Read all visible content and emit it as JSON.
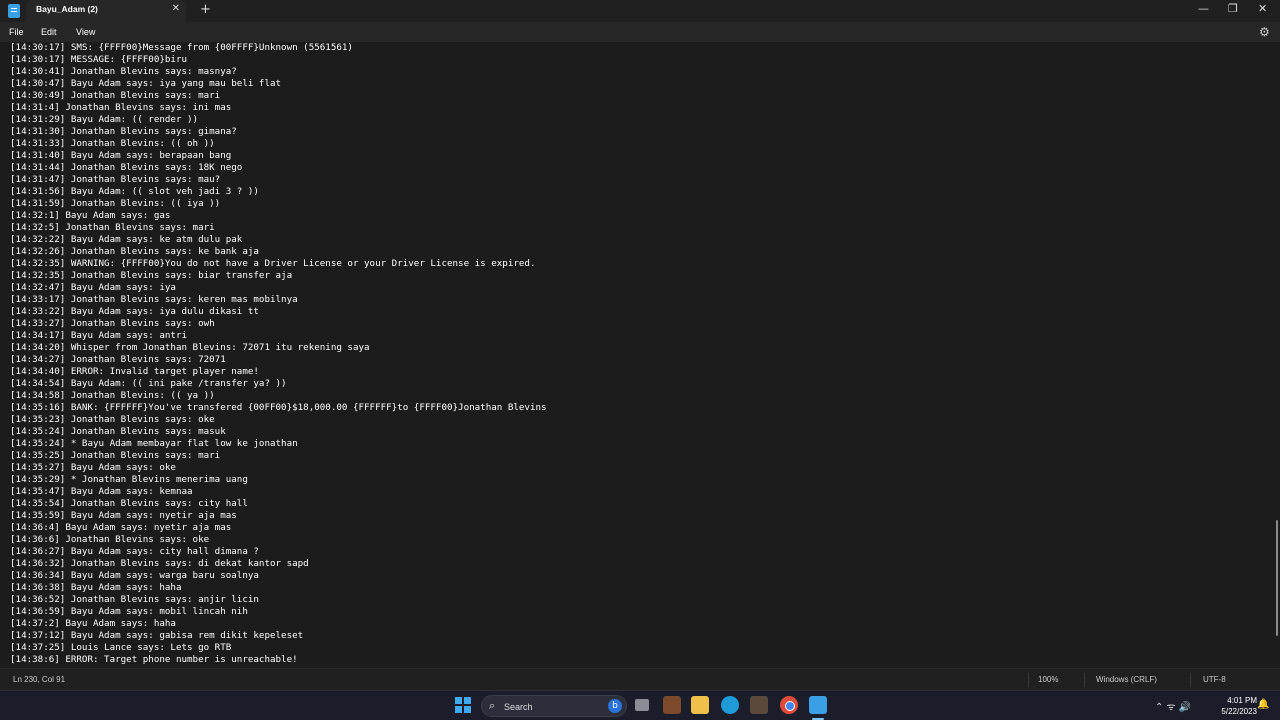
{
  "window": {
    "tab_title": "Bayu_Adam (2)",
    "tab_close": "✕",
    "tab_add": "+",
    "minimize": "—",
    "maximize": "❐",
    "close": "✕"
  },
  "menu": {
    "file": "File",
    "edit": "Edit",
    "view": "View",
    "settings_icon": "gear-icon"
  },
  "lines": [
    "[14:30:17] SMS: {FFFF00}Message from {00FFFF}Unknown (5561561)",
    "[14:30:17] MESSAGE: {FFFF00}biru",
    "[14:30:41] Jonathan Blevins says: masnya?",
    "[14:30:47] Bayu Adam says: iya yang mau beli flat",
    "[14:30:49] Jonathan Blevins says: mari",
    "[14:31:4] Jonathan Blevins says: ini mas",
    "[14:31:29] Bayu Adam: (( render ))",
    "[14:31:30] Jonathan Blevins says: gimana?",
    "[14:31:33] Jonathan Blevins: (( oh ))",
    "[14:31:40] Bayu Adam says: berapaan bang",
    "[14:31:44] Jonathan Blevins says: 18K nego",
    "[14:31:47] Jonathan Blevins says: mau?",
    "[14:31:56] Bayu Adam: (( slot veh jadi 3 ? ))",
    "[14:31:59] Jonathan Blevins: (( iya ))",
    "[14:32:1] Bayu Adam says: gas",
    "[14:32:5] Jonathan Blevins says: mari",
    "[14:32:22] Bayu Adam says: ke atm dulu pak",
    "[14:32:26] Jonathan Blevins says: ke bank aja",
    "[14:32:35] WARNING: {FFFF00}You do not have a Driver License or your Driver License is expired.",
    "[14:32:35] Jonathan Blevins says: biar transfer aja",
    "[14:32:47] Bayu Adam says: iya",
    "[14:33:17] Jonathan Blevins says: keren mas mobilnya",
    "[14:33:22] Bayu Adam says: iya dulu dikasi tt",
    "[14:33:27] Jonathan Blevins says: owh",
    "[14:34:17] Bayu Adam says: antri",
    "[14:34:20] Whisper from Jonathan Blevins: 72071 itu rekening saya",
    "[14:34:27] Jonathan Blevins says: 72071",
    "[14:34:40] ERROR: Invalid target player name!",
    "[14:34:54] Bayu Adam: (( ini pake /transfer ya? ))",
    "[14:34:58] Jonathan Blevins: (( ya ))",
    "[14:35:16] BANK: {FFFFFF}You've transfered {00FF00}$18,000.00 {FFFFFF}to {FFFF00}Jonathan Blevins",
    "[14:35:23] Jonathan Blevins says: oke",
    "[14:35:24] Jonathan Blevins says: masuk",
    "[14:35:24] * Bayu Adam membayar flat low ke jonathan",
    "[14:35:25] Jonathan Blevins says: mari",
    "[14:35:27] Bayu Adam says: oke",
    "[14:35:29] * Jonathan Blevins menerima uang",
    "[14:35:47] Bayu Adam says: kemnaa",
    "[14:35:54] Jonathan Blevins says: city hall",
    "[14:35:59] Bayu Adam says: nyetir aja mas",
    "[14:36:4] Bayu Adam says: nyetir aja mas",
    "[14:36:6] Jonathan Blevins says: oke",
    "[14:36:27] Bayu Adam says: city hall dimana ?",
    "[14:36:32] Jonathan Blevins says: di dekat kantor sapd",
    "[14:36:34] Bayu Adam says: warga baru soalnya",
    "[14:36:38] Bayu Adam says: haha",
    "[14:36:52] Jonathan Blevins says: anjir licin",
    "[14:36:59] Bayu Adam says: mobil lincah nih",
    "[14:37:2] Bayu Adam says: haha",
    "[14:37:12] Bayu Adam says: gabisa rem dikit kepeleset",
    "[14:37:25] Louis Lance says: Lets go RTB",
    "[14:38:6] ERROR: Target phone number is unreachable!"
  ],
  "status": {
    "position": "Ln 230, Col 91",
    "zoom": "100%",
    "line_ending": "Windows (CRLF)",
    "encoding": "UTF-8"
  },
  "taskbar": {
    "search_label": "Search",
    "search_icon": "search-icon",
    "bing_label": "b",
    "tray_icons": "⌃ ᯤ 🔊",
    "time": "4:01 PM",
    "date": "5/22/2023",
    "notification_icon": "🔔"
  }
}
